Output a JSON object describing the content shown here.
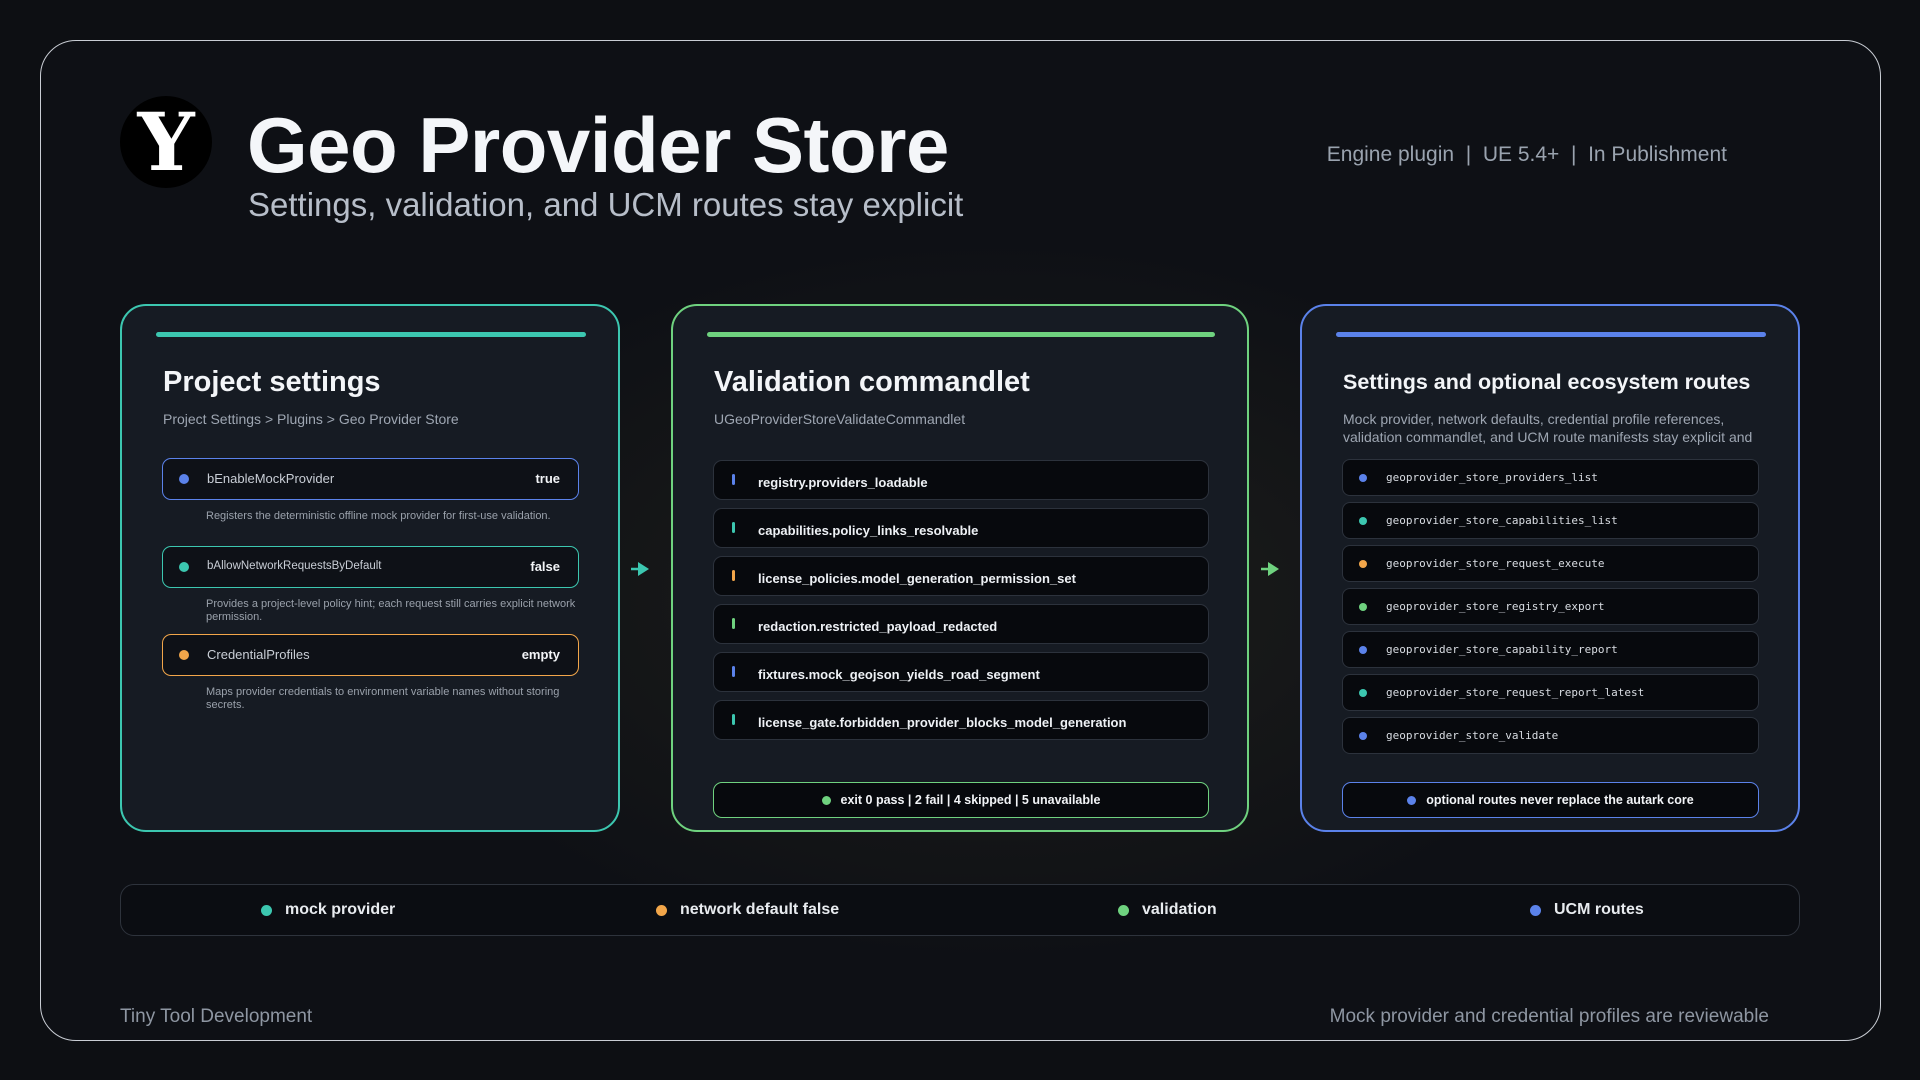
{
  "header": {
    "logo_letter": "Y",
    "title": "Geo Provider Store",
    "subtitle": "Settings, validation, and UCM routes stay explicit",
    "meta": "Engine plugin  |  UE 5.4+  |  In Publishment"
  },
  "colors": {
    "teal": "#3cc7b0",
    "green": "#6fd27f",
    "blue": "#5b82ea",
    "orange": "#f2a64a"
  },
  "project_settings": {
    "title": "Project settings",
    "breadcrumb": "Project Settings > Plugins > Geo Provider Store",
    "settings": [
      {
        "name": "bEnableMockProvider",
        "value": "true",
        "description": "Registers the deterministic offline mock provider for first-use validation."
      },
      {
        "name": "bAllowNetworkRequestsByDefault",
        "value": "false",
        "description": "Provides a project-level policy hint; each request still carries explicit network permission."
      },
      {
        "name": "CredentialProfiles",
        "value": "empty",
        "description": "Maps provider credentials to environment variable names without storing secrets."
      }
    ]
  },
  "validation": {
    "title": "Validation commandlet",
    "subtitle": "UGeoProviderStoreValidateCommandlet",
    "checks": [
      "registry.providers_loadable",
      "capabilities.policy_links_resolvable",
      "license_policies.model_generation_permission_set",
      "redaction.restricted_payload_redacted",
      "fixtures.mock_geojson_yields_road_segment",
      "license_gate.forbidden_provider_blocks_model_generation"
    ],
    "summary": "exit 0 pass | 2 fail | 4 skipped | 5 unavailable"
  },
  "routes": {
    "title": "Settings and optional ecosystem routes",
    "description": "Mock provider, network defaults, credential profile references, validation commandlet, and UCM route manifests stay explicit and",
    "items": [
      "geoprovider_store_providers_list",
      "geoprovider_store_capabilities_list",
      "geoprovider_store_request_execute",
      "geoprovider_store_registry_export",
      "geoprovider_store_capability_report",
      "geoprovider_store_request_report_latest",
      "geoprovider_store_validate"
    ],
    "summary": "optional routes never replace the autark core"
  },
  "legend": [
    {
      "label": "mock provider"
    },
    {
      "label": "network default false"
    },
    {
      "label": "validation"
    },
    {
      "label": "UCM routes"
    }
  ],
  "footer": {
    "left": "Tiny Tool Development",
    "right": "Mock provider and credential profiles are reviewable"
  }
}
